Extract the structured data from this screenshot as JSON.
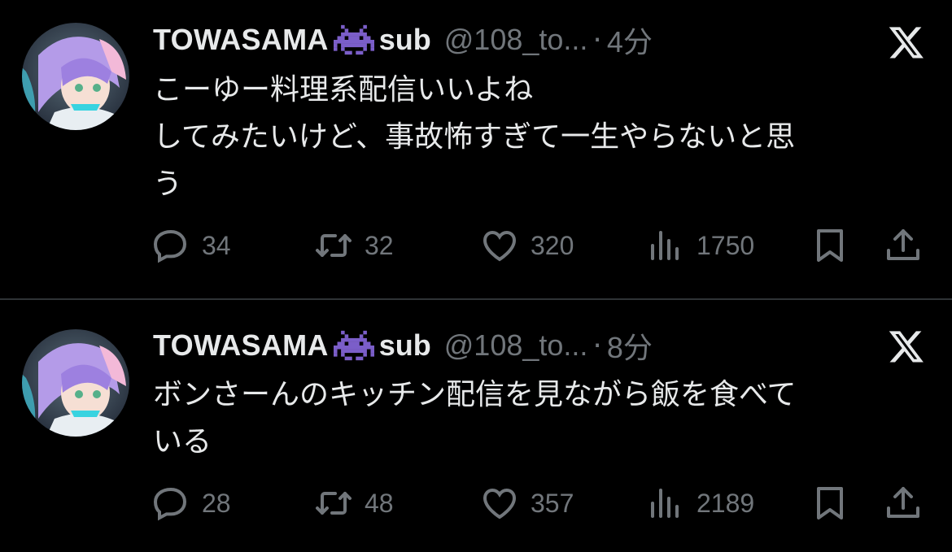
{
  "tweets": [
    {
      "display_name": "TOWASAMA",
      "name_suffix": "sub",
      "handle": "@108_to...",
      "separator": "·",
      "time": "4分",
      "text_lines": [
        "こーゆー料理系配信いいよね",
        "してみたいけど、事故怖すぎて一生やらないと思",
        "う"
      ],
      "replies": "34",
      "retweets": "32",
      "likes": "320",
      "views": "1750"
    },
    {
      "display_name": "TOWASAMA",
      "name_suffix": "sub",
      "handle": "@108_to...",
      "separator": "·",
      "time": "8分",
      "text_lines": [
        "ボンさーんのキッチン配信を見ながら飯を食べて",
        "いる"
      ],
      "replies": "28",
      "retweets": "48",
      "likes": "357",
      "views": "2189"
    }
  ],
  "icons": {
    "verified_emoji": "alien-monster-emoji",
    "logo": "x-logo",
    "reply": "reply-icon",
    "retweet": "retweet-icon",
    "like": "heart-icon",
    "views": "views-icon",
    "bookmark": "bookmark-icon",
    "share": "share-icon"
  },
  "colors": {
    "background": "#000000",
    "text": "#e7e9ea",
    "secondary": "#71767b",
    "emoji": "#7b5ec9",
    "divider": "#2f3336"
  }
}
